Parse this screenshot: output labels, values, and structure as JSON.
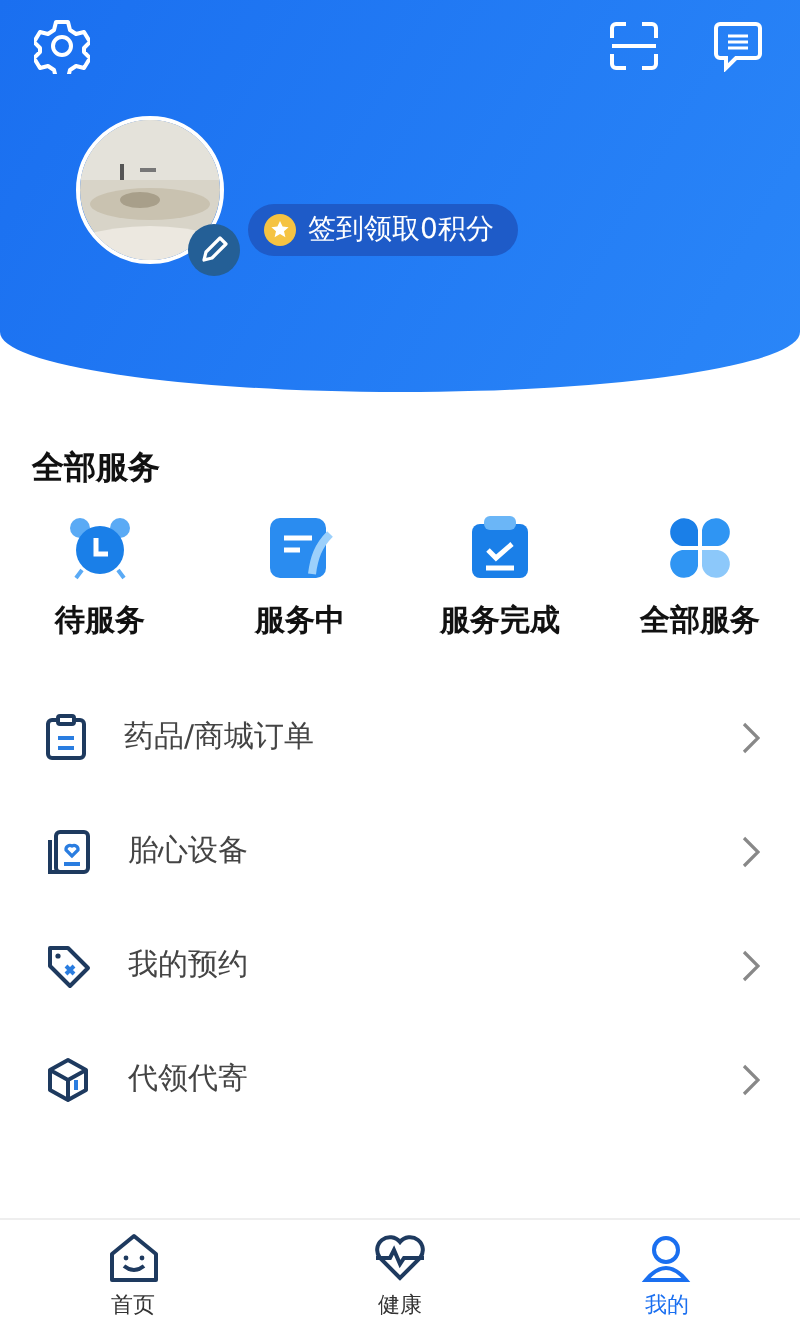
{
  "header": {
    "sign_in": "签到领取0积分"
  },
  "services": {
    "title": "全部服务",
    "items": [
      {
        "kind": "clock",
        "label": "待服务"
      },
      {
        "kind": "note",
        "label": "服务中"
      },
      {
        "kind": "clipboard",
        "label": "服务完成"
      },
      {
        "kind": "grid",
        "label": "全部服务"
      }
    ]
  },
  "menu": [
    {
      "kind": "order",
      "label": "药品/商城订单"
    },
    {
      "kind": "device",
      "label": "胎心设备"
    },
    {
      "kind": "tag",
      "label": "我的预约"
    },
    {
      "kind": "box",
      "label": "代领代寄"
    }
  ],
  "tab_bar": [
    {
      "kind": "home",
      "label": "首页",
      "selected": false
    },
    {
      "kind": "health",
      "label": "健康",
      "selected": false
    },
    {
      "kind": "me",
      "label": "我的",
      "selected": true
    }
  ]
}
